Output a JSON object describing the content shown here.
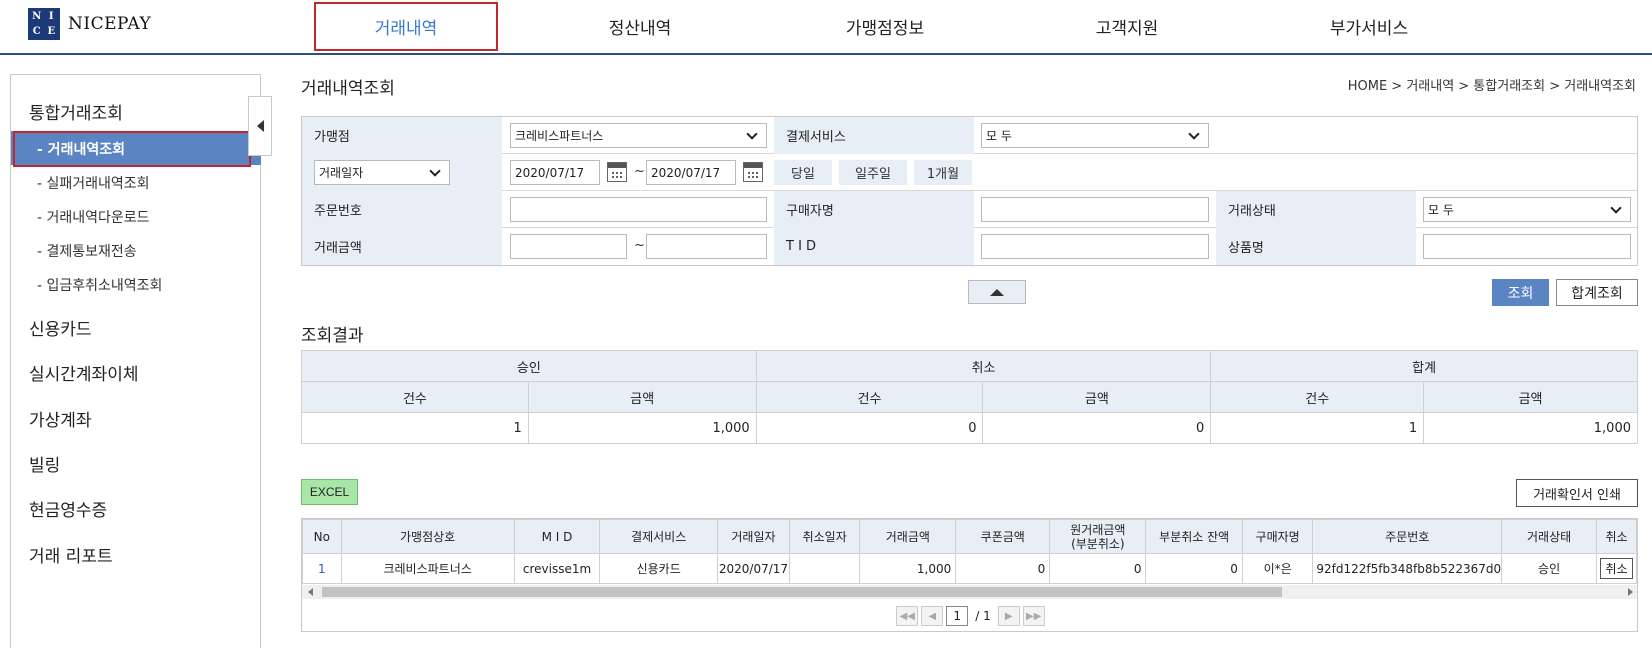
{
  "brand": {
    "name": "NICEPAY",
    "logo_letters": [
      "N",
      "I",
      "C",
      "E"
    ]
  },
  "nav": [
    {
      "label": "거래내역",
      "active": true
    },
    {
      "label": "정산내역"
    },
    {
      "label": "가맹점정보"
    },
    {
      "label": "고객지원"
    },
    {
      "label": "부가서비스"
    }
  ],
  "sidebar": {
    "groups": [
      {
        "label": "통합거래조회"
      },
      {
        "label": "신용카드"
      },
      {
        "label": "실시간계좌이체"
      },
      {
        "label": "가상계좌"
      },
      {
        "label": "빌링"
      },
      {
        "label": "현금영수증"
      },
      {
        "label": "거래 리포트"
      }
    ],
    "sub_items": [
      {
        "label": "- 거래내역조회",
        "active": true
      },
      {
        "label": "- 실패거래내역조회"
      },
      {
        "label": "- 거래내역다운로드"
      },
      {
        "label": "- 결제통보재전송"
      },
      {
        "label": "- 입금후취소내역조회"
      }
    ]
  },
  "page": {
    "title": "거래내역조회",
    "breadcrumb": "HOME > 거래내역 > 통합거래조회 > 거래내역조회"
  },
  "search": {
    "merchant_label": "가맹점",
    "merchant_value": "크레비스파트너스",
    "payment_service_label": "결제서비스",
    "payment_service_value": "모 두",
    "date_type_value": "거래일자",
    "date_from": "2020/07/17",
    "date_to": "2020/07/17",
    "range_sep": "~",
    "quick_today": "당일",
    "quick_week": "일주일",
    "quick_month": "1개월",
    "order_no_label": "주문번호",
    "buyer_label": "구매자명",
    "status_label": "거래상태",
    "status_value": "모 두",
    "amount_label": "거래금액",
    "tid_label": "T I D",
    "product_label": "상품명",
    "search_button": "조회",
    "sum_button": "합계조회"
  },
  "result": {
    "title": "조회결과",
    "summary_groups": [
      "승인",
      "취소",
      "합계"
    ],
    "summary_cols": [
      "건수",
      "금액"
    ],
    "summary_values": [
      "1",
      "1,000",
      "0",
      "0",
      "1",
      "1,000"
    ]
  },
  "actions": {
    "excel": "EXCEL",
    "print": "거래확인서 인쇄"
  },
  "grid": {
    "headers": [
      "No",
      "가맹점상호",
      "M I D",
      "결제서비스",
      "거래일자",
      "취소일자",
      "거래금액",
      "쿠폰금액",
      "원거래금액\n(부분취소)",
      "부분취소 잔액",
      "구매자명",
      "주문번호",
      "거래상태",
      "취소"
    ],
    "rows": [
      {
        "no": "1",
        "merchant": "크레비스파트너스",
        "mid": "crevisse1m",
        "service": "신용카드",
        "date": "2020/07/17",
        "cancel_date": "",
        "amount": "1,000",
        "coupon": "0",
        "orig_amount": "0",
        "partial_balance": "0",
        "buyer": "이*은",
        "order_no": "92fd122f5fb348fb8b522367d0",
        "status": "승인",
        "cancel": "취소"
      }
    ]
  },
  "pager": {
    "current": "1",
    "total": "/ 1"
  }
}
